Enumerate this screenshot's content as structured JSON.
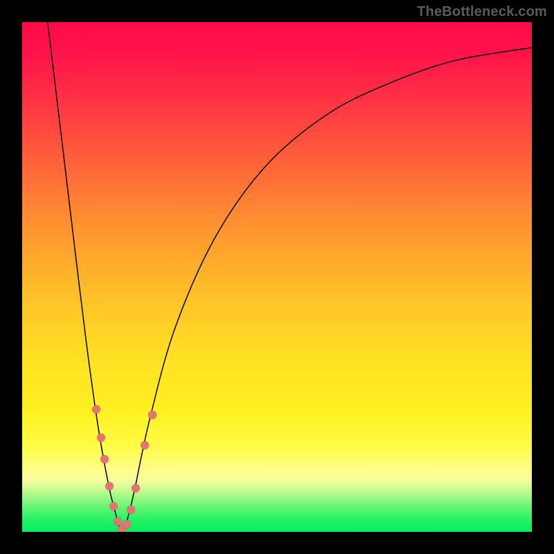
{
  "watermark": "TheBottleneck.com",
  "chart_data": {
    "type": "line",
    "title": "",
    "xlabel": "",
    "ylabel": "",
    "xlim": [
      0,
      100
    ],
    "ylim": [
      0,
      100
    ],
    "gradient_stops": [
      {
        "pct": 0,
        "color": "#ff0a4a"
      },
      {
        "pct": 6,
        "color": "#ff134a"
      },
      {
        "pct": 16,
        "color": "#ff3543"
      },
      {
        "pct": 26,
        "color": "#ff5c3b"
      },
      {
        "pct": 36,
        "color": "#ff8433"
      },
      {
        "pct": 46,
        "color": "#ffa82c"
      },
      {
        "pct": 56,
        "color": "#ffc727"
      },
      {
        "pct": 66,
        "color": "#ffe023"
      },
      {
        "pct": 76,
        "color": "#fff021"
      },
      {
        "pct": 83,
        "color": "#fffb43"
      },
      {
        "pct": 88,
        "color": "#fffd8c"
      },
      {
        "pct": 90,
        "color": "#f3fd9e"
      },
      {
        "pct": 92,
        "color": "#c1fb8f"
      },
      {
        "pct": 94,
        "color": "#85f87e"
      },
      {
        "pct": 96,
        "color": "#4df56f"
      },
      {
        "pct": 98,
        "color": "#1ef264"
      },
      {
        "pct": 100,
        "color": "#03f05e"
      }
    ],
    "series": [
      {
        "name": "curve",
        "points": [
          {
            "x": 5.0,
            "y": 100.0
          },
          {
            "x": 8.0,
            "y": 75.0
          },
          {
            "x": 11.0,
            "y": 50.0
          },
          {
            "x": 13.0,
            "y": 34.0
          },
          {
            "x": 15.0,
            "y": 20.0
          },
          {
            "x": 17.0,
            "y": 9.0
          },
          {
            "x": 18.5,
            "y": 3.0
          },
          {
            "x": 19.5,
            "y": 0.0
          },
          {
            "x": 20.5,
            "y": 2.0
          },
          {
            "x": 22.0,
            "y": 8.0
          },
          {
            "x": 25.0,
            "y": 22.0
          },
          {
            "x": 30.0,
            "y": 40.0
          },
          {
            "x": 38.0,
            "y": 58.0
          },
          {
            "x": 48.0,
            "y": 72.0
          },
          {
            "x": 60.0,
            "y": 82.0
          },
          {
            "x": 72.0,
            "y": 88.0
          },
          {
            "x": 85.0,
            "y": 92.5
          },
          {
            "x": 100.0,
            "y": 95.0
          }
        ]
      }
    ],
    "markers": [
      {
        "x": 14.5,
        "y": 24.0
      },
      {
        "x": 15.5,
        "y": 18.5
      },
      {
        "x": 16.2,
        "y": 14.2
      },
      {
        "x": 17.1,
        "y": 9.0
      },
      {
        "x": 18.0,
        "y": 5.0
      },
      {
        "x": 18.8,
        "y": 2.0
      },
      {
        "x": 19.6,
        "y": 0.5
      },
      {
        "x": 20.5,
        "y": 1.5
      },
      {
        "x": 21.3,
        "y": 4.3
      },
      {
        "x": 22.3,
        "y": 8.5
      },
      {
        "x": 24.0,
        "y": 17.0
      },
      {
        "x": 25.5,
        "y": 23.0
      }
    ],
    "marker_color": "#e57373"
  }
}
